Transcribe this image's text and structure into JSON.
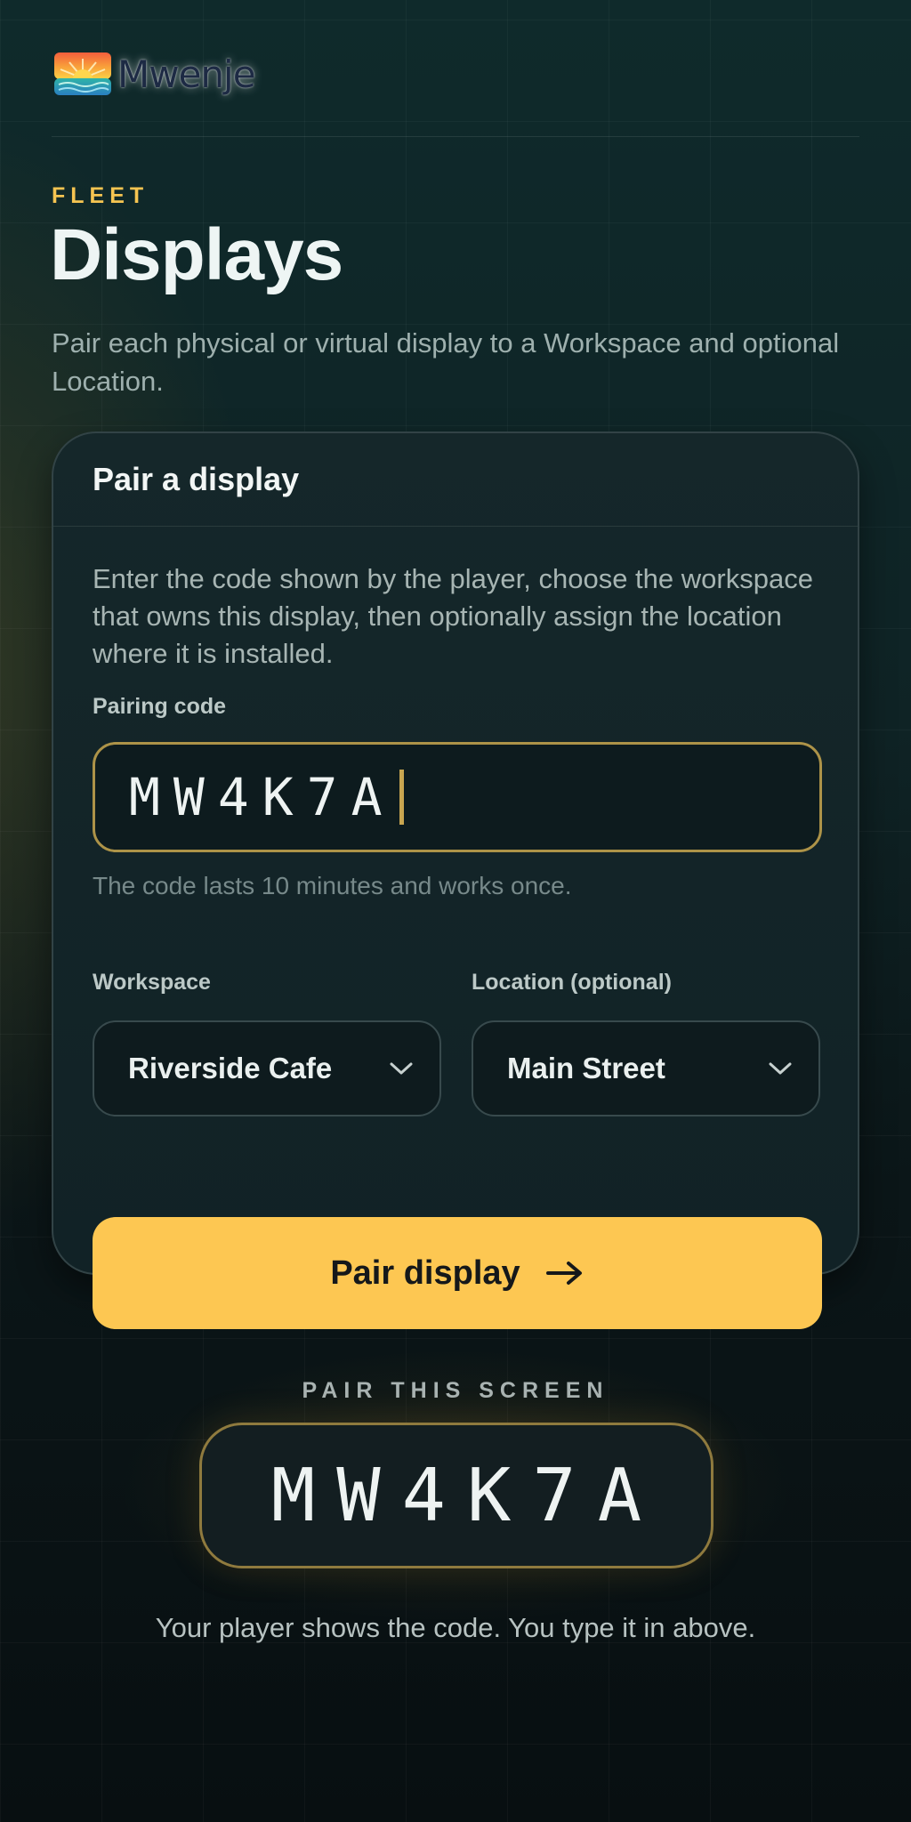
{
  "brand": {
    "name": "Mwenje",
    "logo_icon": "sunrise-logo-icon"
  },
  "header": {
    "eyebrow": "FLEET",
    "title": "Displays",
    "subtitle": "Pair each physical or virtual display to a Workspace and optional Location."
  },
  "card": {
    "title": "Pair a display",
    "intro": "Enter the code shown by the player, choose the workspace that owns this display, then optionally assign the location where it is installed.",
    "pairing_code": {
      "label": "Pairing code",
      "value": "MW4K7A",
      "hint": "The code lasts 10 minutes and works once."
    },
    "workspace": {
      "label": "Workspace",
      "value": "Riverside Cafe",
      "icon": "chevron-down-icon"
    },
    "location": {
      "label": "Location (optional)",
      "value": "Main Street",
      "icon": "chevron-down-icon"
    },
    "submit": {
      "label": "Pair display",
      "icon": "arrow-right-icon"
    }
  },
  "pair_screen": {
    "eyebrow": "PAIR THIS SCREEN",
    "code": "MW4K7A",
    "caption": "Your player shows the code. You type it in above."
  },
  "colors": {
    "accent": "#fdc752",
    "eyebrow": "#f5c451",
    "input_border": "#ad9348",
    "background": "#0f2325"
  }
}
